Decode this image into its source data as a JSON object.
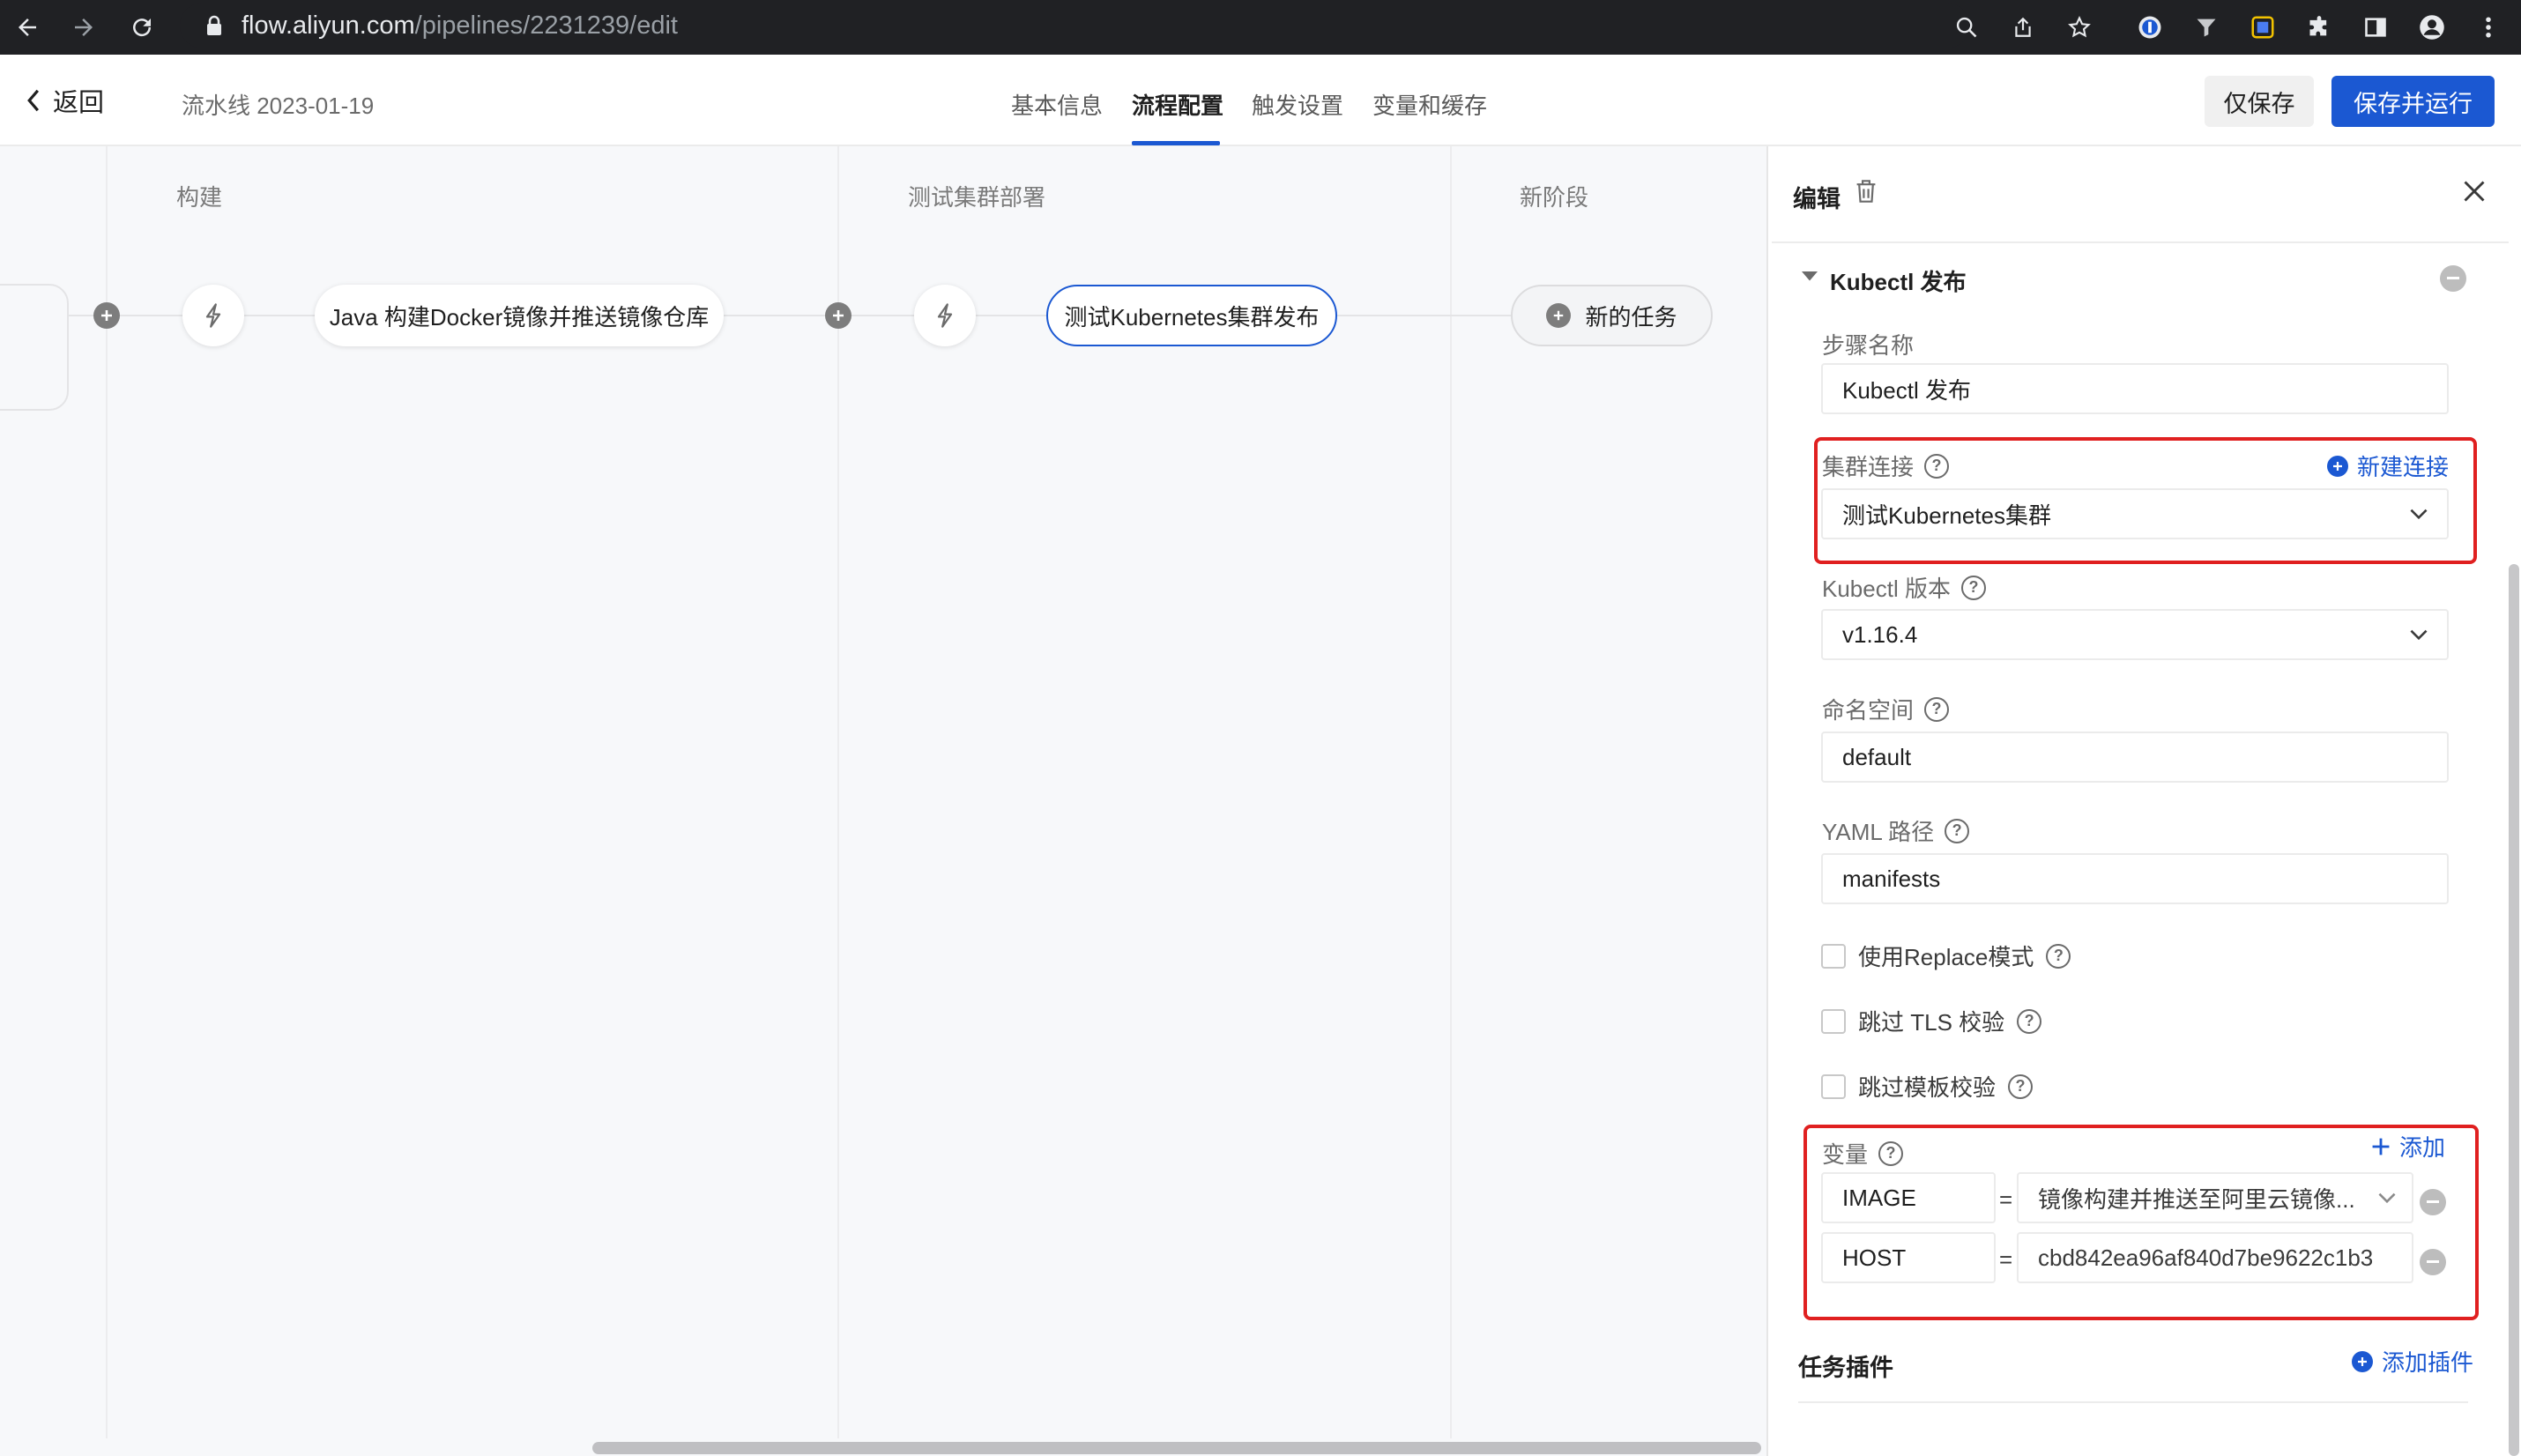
{
  "browser": {
    "url_host": "flow.aliyun.com",
    "url_path": "/pipelines/2231239/edit"
  },
  "header": {
    "back_label": "返回",
    "pipeline_name": "流水线 2023-01-19",
    "tabs": [
      {
        "label": "基本信息",
        "active": false
      },
      {
        "label": "流程配置",
        "active": true
      },
      {
        "label": "触发设置",
        "active": false
      },
      {
        "label": "变量和缓存",
        "active": false
      }
    ],
    "save_only_label": "仅保存",
    "save_run_label": "保存并运行"
  },
  "canvas": {
    "stages": [
      {
        "title": "构建",
        "job": "Java 构建Docker镜像并推送镜像仓库"
      },
      {
        "title": "测试集群部署",
        "job": "测试Kubernetes集群发布"
      },
      {
        "title": "新阶段",
        "job": "新的任务"
      }
    ]
  },
  "panel": {
    "title": "编辑",
    "section_title": "Kubectl 发布",
    "step_name_label": "步骤名称",
    "step_name_value": "Kubectl 发布",
    "cluster_label": "集群连接",
    "new_connection_label": "新建连接",
    "cluster_value": "测试Kubernetes集群",
    "kubectl_version_label": "Kubectl 版本",
    "kubectl_version_value": "v1.16.4",
    "namespace_label": "命名空间",
    "namespace_value": "default",
    "yaml_label": "YAML 路径",
    "yaml_value": "manifests",
    "checkboxes": [
      {
        "label": "使用Replace模式",
        "checked": false
      },
      {
        "label": "跳过 TLS 校验",
        "checked": false
      },
      {
        "label": "跳过模板校验",
        "checked": false
      }
    ],
    "variables_label": "变量",
    "add_label": "添加",
    "variables": [
      {
        "name": "IMAGE",
        "value": "镜像构建并推送至阿里云镜像..."
      },
      {
        "name": "HOST",
        "value": "cbd842ea96af840d7be9622c1b3"
      }
    ],
    "equals": "=",
    "plugins_label": "任务插件",
    "add_plugin_label": "添加插件"
  },
  "colors": {
    "accent": "#1b58d2",
    "highlight_red": "#e02020"
  }
}
